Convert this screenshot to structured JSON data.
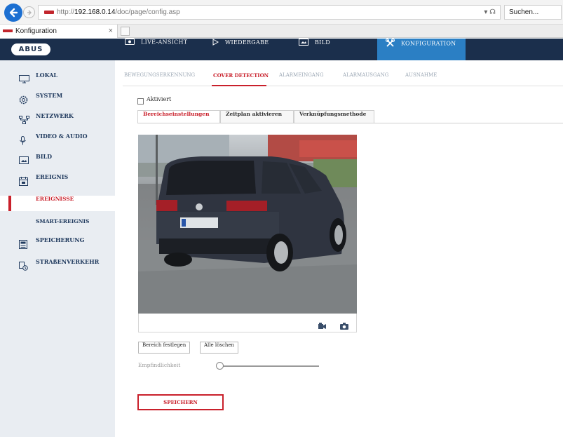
{
  "browser": {
    "address_url": "http://192.168.0.14/doc/page/config.asp",
    "address_host": "192.168.0.14",
    "address_prefix": "http://",
    "address_suffix": "/doc/page/config.asp",
    "search_placeholder": "Suchen...",
    "tab_title": "Konfiguration",
    "tab_close": "×",
    "refresh_glyph": "▾ ☊"
  },
  "header": {
    "logo": "ABUS",
    "tabs": [
      {
        "label": "LIVE-ANSICHT",
        "icon": "eye-icon"
      },
      {
        "label": "WIEDERGABE",
        "icon": "play-icon"
      },
      {
        "label": "BILD",
        "icon": "image-icon"
      },
      {
        "label": "KONFIGURATION",
        "icon": "tools-icon",
        "active": true
      }
    ]
  },
  "sidebar": {
    "items": [
      {
        "label": "LOKAL",
        "icon": "monitor-icon"
      },
      {
        "label": "SYSTEM",
        "icon": "gear-icon"
      },
      {
        "label": "NETZWERK",
        "icon": "network-icon"
      },
      {
        "label": "VIDEO & AUDIO",
        "icon": "microphone-icon"
      },
      {
        "label": "BILD",
        "icon": "image-icon"
      },
      {
        "label": "EREIGNIS",
        "icon": "calendar-icon"
      },
      {
        "label": "EREIGNISSE",
        "active": true
      },
      {
        "label": "SMART-EREIGNIS"
      },
      {
        "label": "SPEICHERUNG",
        "icon": "storage-icon"
      },
      {
        "label": "STRAßENVERKEHR",
        "icon": "traffic-icon"
      }
    ]
  },
  "subtabs": [
    {
      "label": "BEWEGUNGSERKENNUNG"
    },
    {
      "label": "COVER DETECTION",
      "active": true
    },
    {
      "label": "ALARMEINGANG"
    },
    {
      "label": "ALARMAUSGANG"
    },
    {
      "label": "AUSNAHME"
    }
  ],
  "enabled": {
    "label": "Aktiviert",
    "checked": false
  },
  "panel_tabs": [
    {
      "label": "Bereichseinstellungen",
      "active": true
    },
    {
      "label": "Zeitplan aktivieren"
    },
    {
      "label": "Verknüpfungsmethode"
    }
  ],
  "video_tools": [
    "record-icon",
    "camera-icon"
  ],
  "buttons": {
    "set_area": "Bereich festlegen",
    "clear_all": "Alle löschen",
    "save": "SPEICHERN"
  },
  "sensitivity": {
    "label": "Empfindlichkeit",
    "value": 0
  },
  "colors": {
    "brand_dark": "#1b2f4c",
    "accent_blue": "#2b7fc4",
    "accent_red": "#c9202b"
  }
}
